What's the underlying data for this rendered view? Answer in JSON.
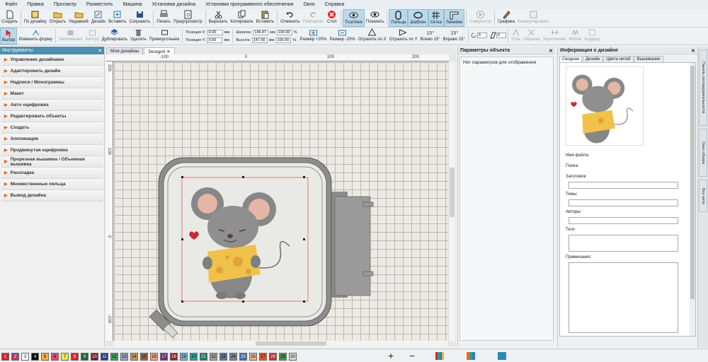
{
  "menu": [
    "Файл",
    "Правка",
    "Просмотр",
    "Разместить",
    "Машина",
    "Установки дизайна",
    "Установки программного обеспечения",
    "Окно",
    "Справка"
  ],
  "toolbar1": [
    {
      "label": "Создать",
      "icon": "new-file-icon"
    },
    {
      "label": "По дизайну",
      "icon": "template-icon"
    },
    {
      "label": "Открыть",
      "icon": "open-folder-icon"
    },
    {
      "label": "Недавний",
      "icon": "recent-folder-icon"
    },
    {
      "label": "Дизайн",
      "icon": "design-icon"
    },
    {
      "label": "Вставить",
      "icon": "insert-icon"
    },
    {
      "label": "Сохранить",
      "icon": "save-icon"
    },
    {
      "label": "Печать",
      "icon": "print-icon"
    },
    {
      "label": "Предпросмотр",
      "icon": "preview-icon"
    },
    {
      "label": "Вырезать",
      "icon": "cut-icon"
    },
    {
      "label": "Копировать",
      "icon": "copy-icon"
    },
    {
      "label": "Вставить",
      "icon": "paste-icon"
    },
    {
      "label": "Отменить",
      "icon": "undo-icon"
    },
    {
      "label": "Повторить",
      "icon": "redo-icon"
    },
    {
      "label": "Стоп",
      "icon": "stop-icon"
    },
    {
      "label": "TrueView",
      "icon": "trueview-eye-icon"
    },
    {
      "label": "Показать",
      "icon": "show-eye-icon"
    },
    {
      "label": "Пяльца",
      "icon": "hoop-icon"
    },
    {
      "label": "Шаблон",
      "icon": "template-hoop-icon"
    },
    {
      "label": "Сетка",
      "icon": "grid-icon"
    },
    {
      "label": "Линейки",
      "icon": "rulers-icon"
    },
    {
      "label": "Симулятор",
      "icon": "simulator-icon"
    },
    {
      "label": "Графика",
      "icon": "graphics-icon"
    },
    {
      "label": "Конвертировать",
      "icon": "convert-icon"
    }
  ],
  "toolbar2": {
    "select": "Выбор",
    "reshape": "Изменить форму",
    "fill": "Заполнение",
    "outline": "Контур",
    "duplicate": "Дублировать",
    "delete": "Удалить",
    "rect": "Прямоугольник",
    "pos_x_label": "Позиция X:",
    "pos_y_label": "Позиция Y:",
    "pos_x": "0.00",
    "pos_y": "0.00",
    "unit": "мм",
    "width_label": "Ширина:",
    "height_label": "Высота:",
    "width": "146.87",
    "height": "147.66",
    "scale_w": "100.00",
    "scale_h": "100.00",
    "pct": "%",
    "size_up": "Размер +20%",
    "size_down": "Размер -20%",
    "mirror_x": "Отразить по X",
    "mirror_y": "Отразить по Y",
    "left15": "Влево 15°",
    "right15": "Вправо 15°",
    "rot_value": "0",
    "slant_value": "0",
    "corners": "Углы",
    "trim": "Обрезка",
    "reinforce": "Укрепление",
    "motif": "Мотив",
    "border": "Бордюр"
  },
  "left_panel": {
    "title": "Инструменты",
    "items": [
      "Управление дизайнами",
      "Адаптировать дизайн",
      "Надписи / Монограммы",
      "Макет",
      "Авто оцифровка",
      "Редактировать объекты",
      "Создать",
      "Аппликация",
      "Продвинутая оцифровка",
      "Прорезная вышивка / Объемная вышивка",
      "Раскладка",
      "Множественные пяльца",
      "Вывод дизайна"
    ]
  },
  "doc_tabs": [
    "Мои дизайны",
    "Design4"
  ],
  "rulers": {
    "top": [
      "-100",
      "0",
      "100",
      "200"
    ],
    "left": [
      "200",
      "100",
      "0",
      "-100"
    ]
  },
  "object_panel": {
    "title": "Параметры объекта",
    "empty_text": "Нет параметров для отображения"
  },
  "info_panel": {
    "title": "Информация о дизайне",
    "tabs": [
      "Сводная",
      "Дизайн",
      "Цвета нитей",
      "Вышивание"
    ],
    "labels": [
      "Имя файла:",
      "Папка:",
      "Заголовок:",
      "Темы:",
      "Авторы:",
      "Теги:",
      "Примечания:"
    ]
  },
  "side_tabs": [
    "Панель последовательности",
    "Окно обзора",
    "Все нити"
  ],
  "palette": [
    "1",
    "2",
    "3",
    "4",
    "5",
    "6",
    "7",
    "8",
    "9",
    "10",
    "11",
    "12",
    "13",
    "14",
    "15",
    "16",
    "17",
    "18",
    "19",
    "20",
    "21",
    "22",
    "23",
    "24",
    "25",
    "26",
    "27",
    "28",
    "29",
    "30"
  ],
  "palette_colors": [
    "#d8262b",
    "#b03a78",
    "#ffffff",
    "#111111",
    "#f2b33d",
    "#e8477c",
    "#f4ec3b",
    "#e32421",
    "#1e6e2f",
    "#7a1a2b",
    "#2b3b8f",
    "#3aa35a",
    "#9aa2c8",
    "#c49a54",
    "#9b6a3a",
    "#f2a07a",
    "#6b2a7a",
    "#9a1f2e",
    "#6fb4d8",
    "#2ba5a0",
    "#1d7a6a",
    "#a0a0a0",
    "#5a7a9a",
    "#808890",
    "#3c6fb3",
    "#e8b58a",
    "#f0541f",
    "#c72d2f",
    "#3f9a4a",
    "#cfe0c8"
  ]
}
